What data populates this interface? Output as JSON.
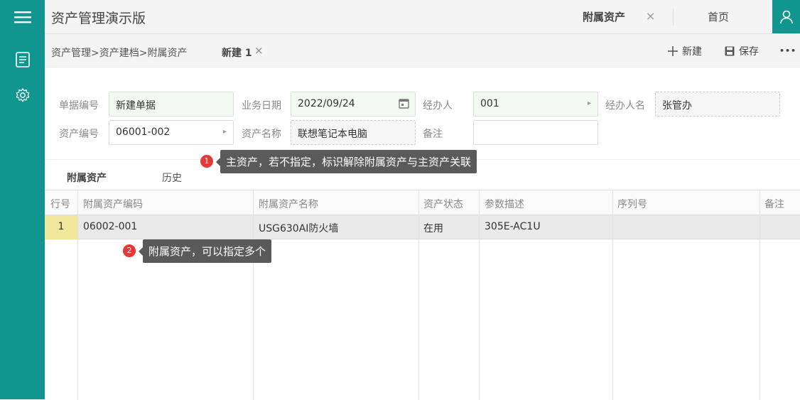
{
  "app": {
    "title": "资产管理演示版"
  },
  "top_tabs": {
    "active": "附属资产",
    "close": "×",
    "home": "首页"
  },
  "breadcrumb": "资产管理>资产建档>附属资产",
  "doc_tab": {
    "label": "新建 1",
    "close": "×"
  },
  "toolbar": {
    "new_label": "新建",
    "save_label": "保存",
    "more_label": "•••"
  },
  "form": {
    "doc_no": {
      "label": "单据编号",
      "value": "新建单据"
    },
    "biz_date": {
      "label": "业务日期",
      "value": "2022/09/24"
    },
    "handler": {
      "label": "经办人",
      "value": "001"
    },
    "handler_name": {
      "label": "经办人名",
      "value": "张管办"
    },
    "asset_no": {
      "label": "资产编号",
      "value": "06001-002"
    },
    "asset_name": {
      "label": "资产名称",
      "value": "联想笔记本电脑"
    },
    "remark": {
      "label": "备注",
      "value": ""
    }
  },
  "sub_tabs": {
    "attached": "附属资产",
    "history": "历史"
  },
  "grid": {
    "headers": [
      "行号",
      "附属资产编码",
      "附属资产名称",
      "资产状态",
      "参数描述",
      "序列号",
      "备注"
    ],
    "rows": [
      {
        "no": "1",
        "code": "06002-001",
        "name": "USG630AI防火墙",
        "status": "在用",
        "param": "305E-AC1U",
        "serial": "",
        "remark": ""
      }
    ]
  },
  "tips": [
    {
      "badge": "1",
      "text": "主资产，若不指定，标识解除附属资产与主资产关联"
    },
    {
      "badge": "2",
      "text": "附属资产，可以指定多个"
    }
  ],
  "colors": {
    "brand": "#11958f",
    "row_highlight": "#f0e79a",
    "tip_bg": "#5a5a5a",
    "badge": "#e53935"
  },
  "icons": [
    "menu-icon",
    "document-icon",
    "gear-icon",
    "user-icon",
    "plus-icon",
    "save-icon",
    "calendar-icon"
  ]
}
